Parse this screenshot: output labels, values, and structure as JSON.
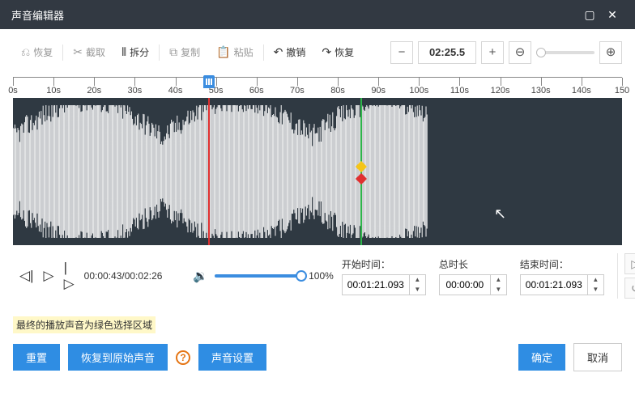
{
  "titlebar": {
    "title": "声音编辑器"
  },
  "toolbar": {
    "restore": "恢复",
    "cut": "截取",
    "split": "拆分",
    "copy": "复制",
    "paste": "粘贴",
    "undo": "撤销",
    "redo": "恢复",
    "time_display": "02:25.5"
  },
  "ruler": {
    "labels": [
      "0s",
      "10s",
      "20s",
      "30s",
      "40s",
      "50s",
      "60s",
      "70s",
      "80s",
      "90s",
      "100s",
      "110s",
      "120s",
      "130s",
      "140s",
      "150"
    ]
  },
  "playback": {
    "time_display": "00:00:43/00:02:26",
    "volume_pct": "100%"
  },
  "fields": {
    "start_label": "开始时间：",
    "duration_label": "总时长",
    "end_label": "结束时间：",
    "start_value": "00:01:21.093",
    "duration_value": "00:00:00",
    "end_value": "00:01:21.093"
  },
  "hint": "最终的播放声音为绿色选择区域",
  "footer": {
    "reset": "重置",
    "restore_original": "恢复到原始声音",
    "sound_settings": "声音设置",
    "ok": "确定",
    "cancel": "取消"
  },
  "chart_data": {
    "type": "waveform",
    "duration_seconds": 150,
    "audio_end_seconds": 102,
    "playhead_seconds": 43,
    "marker_green_seconds": 81,
    "amplitude_range": [
      -1,
      1
    ]
  }
}
